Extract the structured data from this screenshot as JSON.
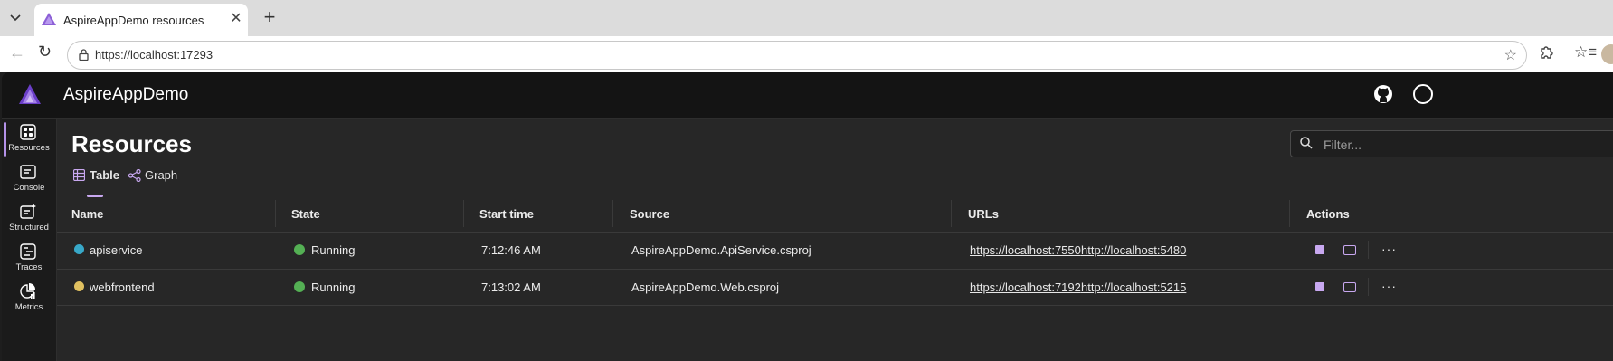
{
  "browser": {
    "tab_title": "AspireAppDemo resources",
    "close_glyph": "✕",
    "new_tab_glyph": "+",
    "url": "https://localhost:17293"
  },
  "app": {
    "title": "AspireAppDemo",
    "page_title": "Resources",
    "filter_placeholder": "Filter...",
    "accent_color": "#b492e8"
  },
  "sidenav": {
    "items": [
      {
        "label": "Resources",
        "icon": "grid-icon",
        "active": true
      },
      {
        "label": "Console",
        "icon": "console-icon"
      },
      {
        "label": "Structured",
        "icon": "structured-icon"
      },
      {
        "label": "Traces",
        "icon": "traces-icon"
      },
      {
        "label": "Metrics",
        "icon": "metrics-icon"
      }
    ]
  },
  "views": {
    "table": "Table",
    "graph": "Graph",
    "selected": "Table"
  },
  "table": {
    "headers": {
      "name": "Name",
      "state": "State",
      "start_time": "Start time",
      "source": "Source",
      "urls": "URLs",
      "actions": "Actions"
    },
    "rows": [
      {
        "name": "apiservice",
        "icon_color": "#38a8c8",
        "state": "Running",
        "start_time": "7:12:46 AM",
        "source": "AspireAppDemo.ApiService.csproj",
        "url1": "https://localhost:7550",
        "url2": "http://localhost:5480"
      },
      {
        "name": "webfrontend",
        "icon_color": "#e0c060",
        "state": "Running",
        "start_time": "7:13:02 AM",
        "source": "AspireAppDemo.Web.csproj",
        "url1": "https://localhost:7192",
        "url2": "http://localhost:5215"
      }
    ],
    "more_glyph": "···"
  }
}
